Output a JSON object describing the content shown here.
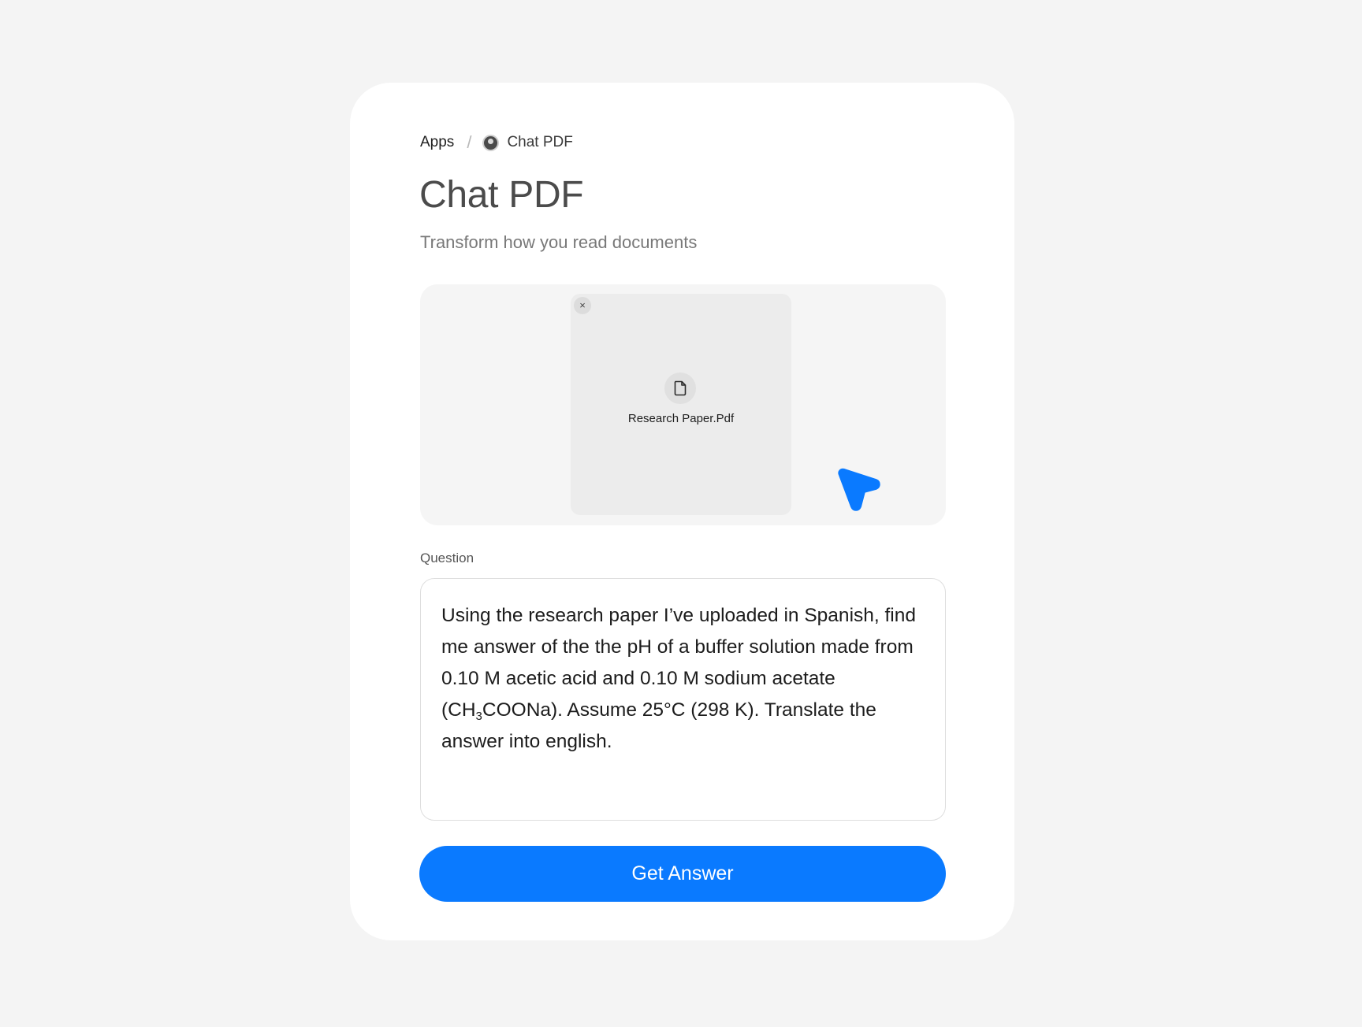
{
  "breadcrumb": {
    "root": "Apps",
    "separator": "/",
    "current": "Chat PDF"
  },
  "header": {
    "title": "Chat PDF",
    "subtitle": "Transform how you read documents"
  },
  "upload": {
    "file_name": "Research Paper.Pdf",
    "close_symbol": "×",
    "file_icon": "document-icon",
    "cursor_icon": "pointer-arrow-icon"
  },
  "question": {
    "label": "Question",
    "text_before_sub": "Using the research paper I’ve uploaded in Spanish, find me answer of the the pH of a buffer solution made from 0.10 M acetic acid and 0.10 M sodium acetate (CH",
    "subscript": "3",
    "text_after_sub": "COONa). Assume 25°C (298 K). Translate the answer into english."
  },
  "actions": {
    "submit_label": "Get Answer"
  },
  "colors": {
    "accent": "#0a7aff",
    "background": "#f4f4f4",
    "card": "#ffffff"
  }
}
